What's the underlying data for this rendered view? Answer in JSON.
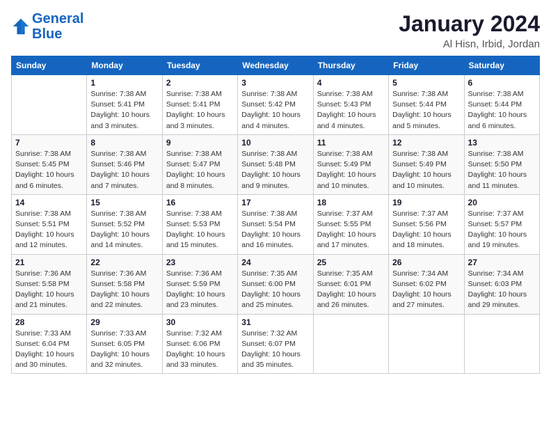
{
  "logo": {
    "line1": "General",
    "line2": "Blue"
  },
  "title": "January 2024",
  "subtitle": "Al Hisn, Irbid, Jordan",
  "days_of_week": [
    "Sunday",
    "Monday",
    "Tuesday",
    "Wednesday",
    "Thursday",
    "Friday",
    "Saturday"
  ],
  "weeks": [
    [
      {
        "day": "",
        "info": ""
      },
      {
        "day": "1",
        "info": "Sunrise: 7:38 AM\nSunset: 5:41 PM\nDaylight: 10 hours\nand 3 minutes."
      },
      {
        "day": "2",
        "info": "Sunrise: 7:38 AM\nSunset: 5:41 PM\nDaylight: 10 hours\nand 3 minutes."
      },
      {
        "day": "3",
        "info": "Sunrise: 7:38 AM\nSunset: 5:42 PM\nDaylight: 10 hours\nand 4 minutes."
      },
      {
        "day": "4",
        "info": "Sunrise: 7:38 AM\nSunset: 5:43 PM\nDaylight: 10 hours\nand 4 minutes."
      },
      {
        "day": "5",
        "info": "Sunrise: 7:38 AM\nSunset: 5:44 PM\nDaylight: 10 hours\nand 5 minutes."
      },
      {
        "day": "6",
        "info": "Sunrise: 7:38 AM\nSunset: 5:44 PM\nDaylight: 10 hours\nand 6 minutes."
      }
    ],
    [
      {
        "day": "7",
        "info": "Sunrise: 7:38 AM\nSunset: 5:45 PM\nDaylight: 10 hours\nand 6 minutes."
      },
      {
        "day": "8",
        "info": "Sunrise: 7:38 AM\nSunset: 5:46 PM\nDaylight: 10 hours\nand 7 minutes."
      },
      {
        "day": "9",
        "info": "Sunrise: 7:38 AM\nSunset: 5:47 PM\nDaylight: 10 hours\nand 8 minutes."
      },
      {
        "day": "10",
        "info": "Sunrise: 7:38 AM\nSunset: 5:48 PM\nDaylight: 10 hours\nand 9 minutes."
      },
      {
        "day": "11",
        "info": "Sunrise: 7:38 AM\nSunset: 5:49 PM\nDaylight: 10 hours\nand 10 minutes."
      },
      {
        "day": "12",
        "info": "Sunrise: 7:38 AM\nSunset: 5:49 PM\nDaylight: 10 hours\nand 10 minutes."
      },
      {
        "day": "13",
        "info": "Sunrise: 7:38 AM\nSunset: 5:50 PM\nDaylight: 10 hours\nand 11 minutes."
      }
    ],
    [
      {
        "day": "14",
        "info": "Sunrise: 7:38 AM\nSunset: 5:51 PM\nDaylight: 10 hours\nand 12 minutes."
      },
      {
        "day": "15",
        "info": "Sunrise: 7:38 AM\nSunset: 5:52 PM\nDaylight: 10 hours\nand 14 minutes."
      },
      {
        "day": "16",
        "info": "Sunrise: 7:38 AM\nSunset: 5:53 PM\nDaylight: 10 hours\nand 15 minutes."
      },
      {
        "day": "17",
        "info": "Sunrise: 7:38 AM\nSunset: 5:54 PM\nDaylight: 10 hours\nand 16 minutes."
      },
      {
        "day": "18",
        "info": "Sunrise: 7:37 AM\nSunset: 5:55 PM\nDaylight: 10 hours\nand 17 minutes."
      },
      {
        "day": "19",
        "info": "Sunrise: 7:37 AM\nSunset: 5:56 PM\nDaylight: 10 hours\nand 18 minutes."
      },
      {
        "day": "20",
        "info": "Sunrise: 7:37 AM\nSunset: 5:57 PM\nDaylight: 10 hours\nand 19 minutes."
      }
    ],
    [
      {
        "day": "21",
        "info": "Sunrise: 7:36 AM\nSunset: 5:58 PM\nDaylight: 10 hours\nand 21 minutes."
      },
      {
        "day": "22",
        "info": "Sunrise: 7:36 AM\nSunset: 5:58 PM\nDaylight: 10 hours\nand 22 minutes."
      },
      {
        "day": "23",
        "info": "Sunrise: 7:36 AM\nSunset: 5:59 PM\nDaylight: 10 hours\nand 23 minutes."
      },
      {
        "day": "24",
        "info": "Sunrise: 7:35 AM\nSunset: 6:00 PM\nDaylight: 10 hours\nand 25 minutes."
      },
      {
        "day": "25",
        "info": "Sunrise: 7:35 AM\nSunset: 6:01 PM\nDaylight: 10 hours\nand 26 minutes."
      },
      {
        "day": "26",
        "info": "Sunrise: 7:34 AM\nSunset: 6:02 PM\nDaylight: 10 hours\nand 27 minutes."
      },
      {
        "day": "27",
        "info": "Sunrise: 7:34 AM\nSunset: 6:03 PM\nDaylight: 10 hours\nand 29 minutes."
      }
    ],
    [
      {
        "day": "28",
        "info": "Sunrise: 7:33 AM\nSunset: 6:04 PM\nDaylight: 10 hours\nand 30 minutes."
      },
      {
        "day": "29",
        "info": "Sunrise: 7:33 AM\nSunset: 6:05 PM\nDaylight: 10 hours\nand 32 minutes."
      },
      {
        "day": "30",
        "info": "Sunrise: 7:32 AM\nSunset: 6:06 PM\nDaylight: 10 hours\nand 33 minutes."
      },
      {
        "day": "31",
        "info": "Sunrise: 7:32 AM\nSunset: 6:07 PM\nDaylight: 10 hours\nand 35 minutes."
      },
      {
        "day": "",
        "info": ""
      },
      {
        "day": "",
        "info": ""
      },
      {
        "day": "",
        "info": ""
      }
    ]
  ]
}
